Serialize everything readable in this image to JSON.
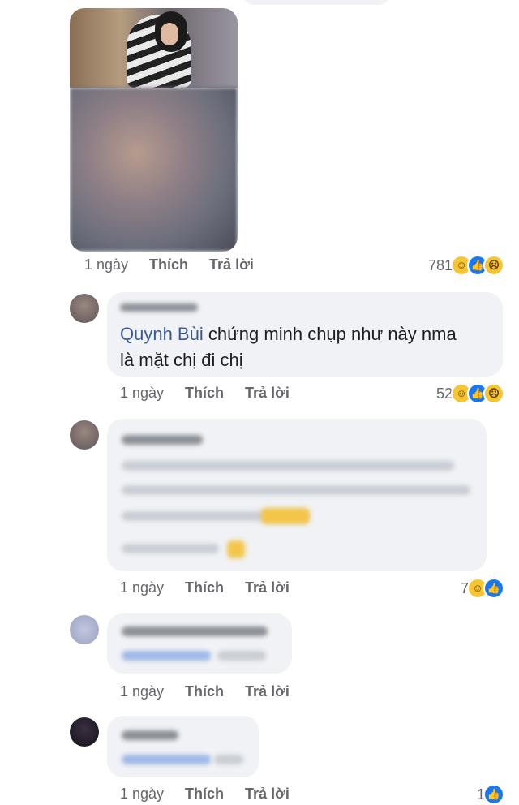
{
  "comments": [
    {
      "time": "1 ngày",
      "like_label": "Thích",
      "reply_label": "Trả lời",
      "reaction_count": "781",
      "reactions": [
        "haha-icon",
        "like-icon",
        "sad-icon"
      ]
    },
    {
      "mention": "Quynh Bùi",
      "text_line1": " chứng minh chụp như này nma",
      "text_line2": "là mặt chị đi chị",
      "time": "1 ngày",
      "like_label": "Thích",
      "reply_label": "Trả lời",
      "reaction_count": "52",
      "reactions": [
        "haha-icon",
        "like-icon",
        "sad-icon"
      ]
    },
    {
      "time": "1 ngày",
      "like_label": "Thích",
      "reply_label": "Trả lời",
      "reaction_count": "7",
      "reactions": [
        "haha-icon",
        "like-icon"
      ]
    },
    {
      "time": "1 ngày",
      "like_label": "Thích",
      "reply_label": "Trả lời"
    },
    {
      "time": "1 ngày",
      "like_label": "Thích",
      "reply_label": "Trả lời",
      "reaction_count": "1",
      "reactions": [
        "like-icon"
      ]
    }
  ],
  "colors": {
    "link": "#385898",
    "like": "#1877f2",
    "bubble": "#f0f2f5",
    "meta": "#65676b"
  }
}
